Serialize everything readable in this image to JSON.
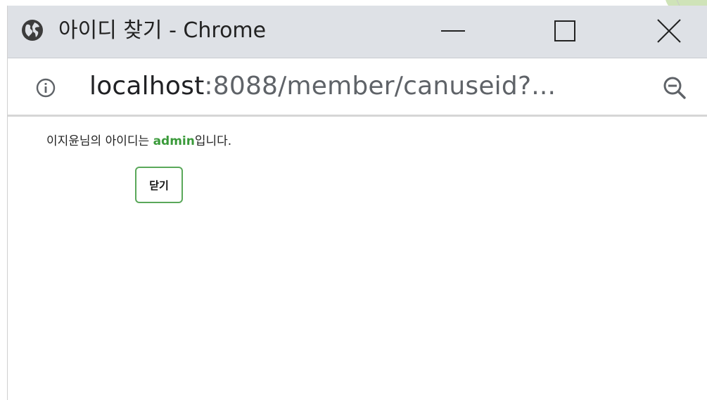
{
  "window": {
    "title": "아이디 찾기 - Chrome"
  },
  "address_bar": {
    "url_host": "localhost",
    "url_rest": ":8088/member/canuseid?..."
  },
  "page": {
    "message_prefix": "이지윤님의 아이디는 ",
    "user_id": "admin",
    "message_suffix": "입니다.",
    "close_button_label": "닫기"
  },
  "icons": {
    "site": "globe-icon",
    "security": "info-icon",
    "zoom": "zoom-out-icon",
    "minimize": "minimize-icon",
    "maximize": "maximize-icon",
    "close": "close-icon"
  },
  "colors": {
    "titlebar_bg": "#dee1e6",
    "accent_green": "#3a9a3a",
    "button_border": "#5aa85a"
  }
}
